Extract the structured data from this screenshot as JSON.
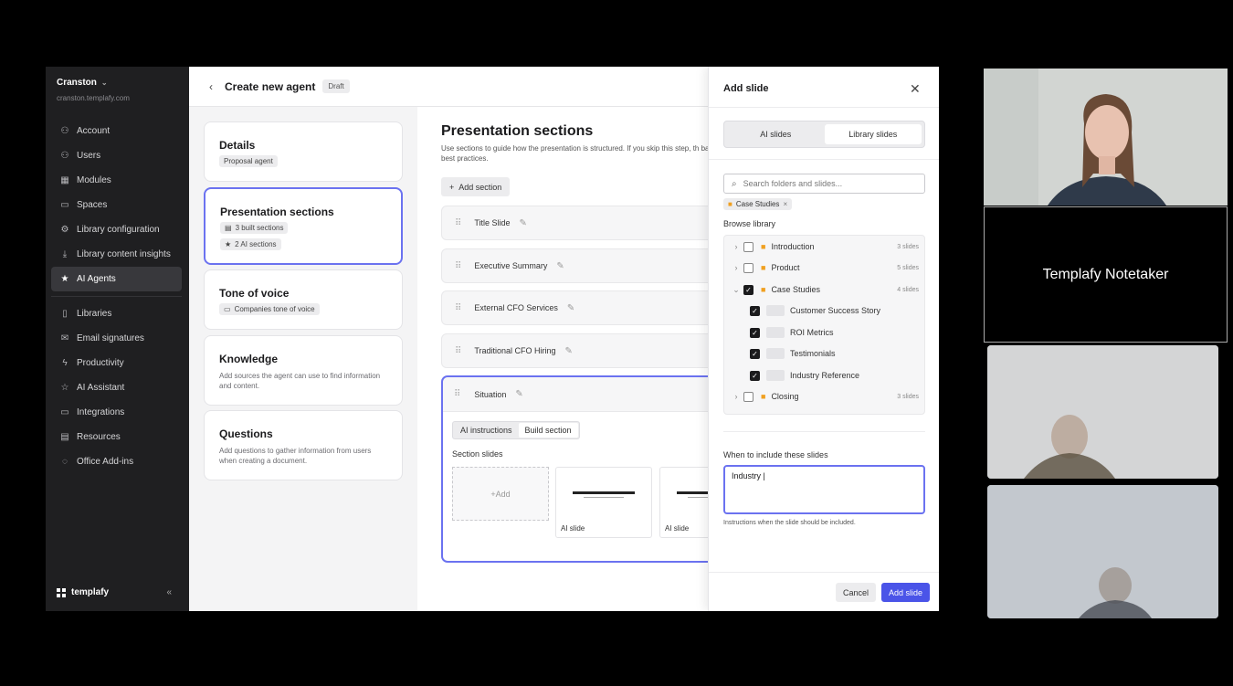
{
  "sidebar": {
    "org_name": "Cranston",
    "org_url": "cranston.templafy.com",
    "items": [
      {
        "label": "Account",
        "icon": "person-icon"
      },
      {
        "label": "Users",
        "icon": "users-icon"
      },
      {
        "label": "Modules",
        "icon": "grid-icon"
      },
      {
        "label": "Spaces",
        "icon": "folder-icon"
      },
      {
        "label": "Library configuration",
        "icon": "gear-icon"
      },
      {
        "label": "Library content insights",
        "icon": "download-icon"
      },
      {
        "label": "AI Agents",
        "icon": "star-icon",
        "active": true
      }
    ],
    "items2": [
      {
        "label": "Libraries",
        "icon": "book-icon"
      },
      {
        "label": "Email signatures",
        "icon": "mail-icon"
      },
      {
        "label": "Productivity",
        "icon": "bolt-icon"
      },
      {
        "label": "AI Assistant",
        "icon": "star-outline-icon"
      },
      {
        "label": "Integrations",
        "icon": "monitor-icon"
      },
      {
        "label": "Resources",
        "icon": "document-icon"
      },
      {
        "label": "Office Add-ins",
        "icon": "dotted-circle-icon"
      }
    ],
    "brand": "templafy",
    "collapse": "«"
  },
  "topbar": {
    "back": "‹",
    "title": "Create new agent",
    "status": "Draft"
  },
  "steps": [
    {
      "title": "Details",
      "chips": [
        "Proposal agent"
      ]
    },
    {
      "title": "Presentation sections",
      "chips": [
        "3 built sections",
        "2 AI sections"
      ]
    },
    {
      "title": "Tone of voice",
      "chips": [
        "Companies tone of voice"
      ]
    },
    {
      "title": "Knowledge",
      "desc": "Add sources the agent can use to find information and content."
    },
    {
      "title": "Questions",
      "desc": "Add questions to gather information from users when creating a document."
    }
  ],
  "main": {
    "title": "Presentation sections",
    "desc": "Use sections to guide how the presentation is structured. If you skip this step, th based on best practices.",
    "add_section": "Add section",
    "sections": [
      "Title Slide",
      "Executive Summary",
      "External CFO Services",
      "Traditional CFO Hiring"
    ],
    "expanded": {
      "name": "Situation",
      "tab_ai": "AI instructions",
      "tab_build": "Build section",
      "slides_label": "Section slides",
      "add": "+Add",
      "thumbs": [
        "AI slide",
        "AI slide"
      ]
    }
  },
  "panel": {
    "title": "Add slide",
    "tab_ai": "AI slides",
    "tab_library": "Library slides",
    "search_placeholder": "Search folders and slides...",
    "filter_tag": "Case Studies",
    "browse_label": "Browse library",
    "tree": [
      {
        "name": "Introduction",
        "count": "3 slides",
        "checked": false
      },
      {
        "name": "Product",
        "count": "5 slides",
        "checked": false
      },
      {
        "name": "Case Studies",
        "count": "4 slides",
        "checked": true
      },
      {
        "name": "Customer Success Story",
        "child": true,
        "checked": true
      },
      {
        "name": "ROI Metrics",
        "child": true,
        "checked": true
      },
      {
        "name": "Testimonials",
        "child": true,
        "checked": true
      },
      {
        "name": "Industry Reference",
        "child": true,
        "checked": true
      },
      {
        "name": "Closing",
        "count": "3 slides",
        "checked": false
      }
    ],
    "when_label": "When to include these slides",
    "when_value": "Industry |",
    "hint": "Instructions when the slide should be included.",
    "cancel": "Cancel",
    "add": "Add slide"
  },
  "video": {
    "notetaker": "Templafy Notetaker"
  },
  "colors": {
    "accent": "#4a54e8",
    "selected_border": "#6b72f0",
    "sidebar_bg": "#1f1f21",
    "folder": "#f0a020"
  }
}
